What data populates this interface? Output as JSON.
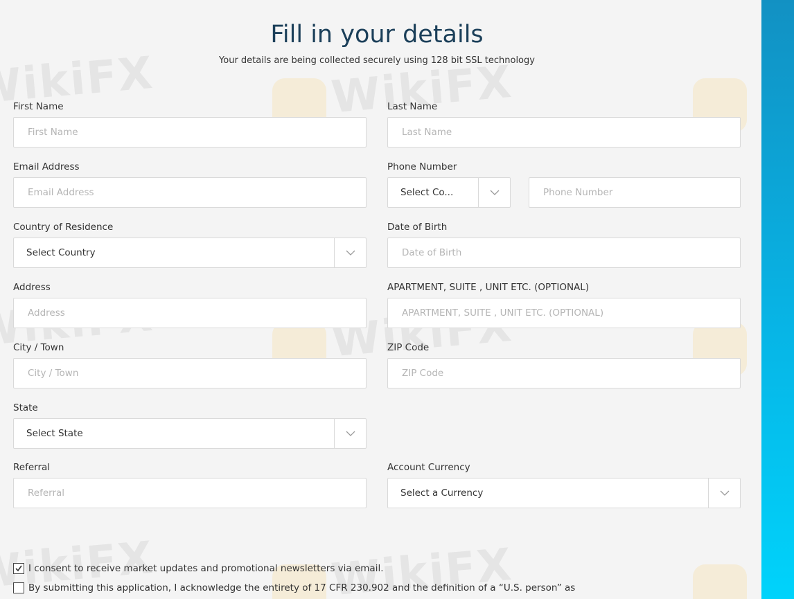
{
  "header": {
    "title": "Fill in your details",
    "subtitle": "Your details are being collected securely using 128 bit SSL technology"
  },
  "watermark": {
    "text": "WikiFX"
  },
  "form": {
    "first_name": {
      "label": "First Name",
      "placeholder": "First Name",
      "value": ""
    },
    "last_name": {
      "label": "Last Name",
      "placeholder": "Last Name",
      "value": ""
    },
    "email": {
      "label": "Email Address",
      "placeholder": "Email Address",
      "value": ""
    },
    "phone": {
      "label": "Phone Number",
      "country_code_selected": "Select Co...",
      "placeholder": "Phone Number",
      "value": ""
    },
    "country": {
      "label": "Country of Residence",
      "selected": "Select Country"
    },
    "dob": {
      "label": "Date of Birth",
      "placeholder": "Date of Birth",
      "value": ""
    },
    "address": {
      "label": "Address",
      "placeholder": "Address",
      "value": ""
    },
    "apartment": {
      "label": "APARTMENT, SUITE , UNIT ETC. (OPTIONAL)",
      "placeholder": "APARTMENT, SUITE , UNIT ETC. (OPTIONAL)",
      "value": ""
    },
    "city": {
      "label": "City / Town",
      "placeholder": "City / Town",
      "value": ""
    },
    "zip": {
      "label": "ZIP Code",
      "placeholder": "ZIP Code",
      "value": ""
    },
    "state": {
      "label": "State",
      "selected": "Select State"
    },
    "referral": {
      "label": "Referral",
      "placeholder": "Referral",
      "value": ""
    },
    "currency": {
      "label": "Account Currency",
      "selected": "Select a Currency"
    }
  },
  "consents": [
    {
      "text": "I consent to receive market updates and promotional newsletters via email.",
      "checked": true
    },
    {
      "text": "By submitting this application, I acknowledge the entirety of 17 CFR 230.902 and the definition of a “U.S. person” as",
      "checked": false
    }
  ],
  "icons": {
    "dropdown": "chevron-down-icon",
    "check": "checkmark-icon"
  },
  "colors": {
    "title": "#1b3f59",
    "accent_bar_top": "#1291c3",
    "accent_bar_bottom": "#00d3fb"
  }
}
